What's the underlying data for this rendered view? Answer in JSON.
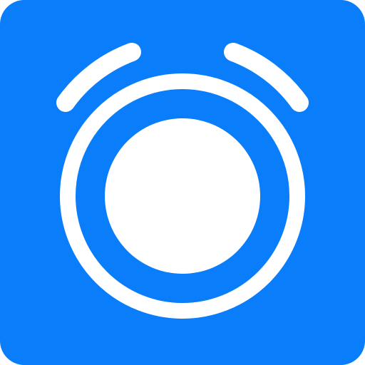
{
  "icon": {
    "name": "alarm-clock-icon",
    "colors": {
      "background": "#0A7DFB",
      "foreground": "#FFFFFF"
    }
  }
}
